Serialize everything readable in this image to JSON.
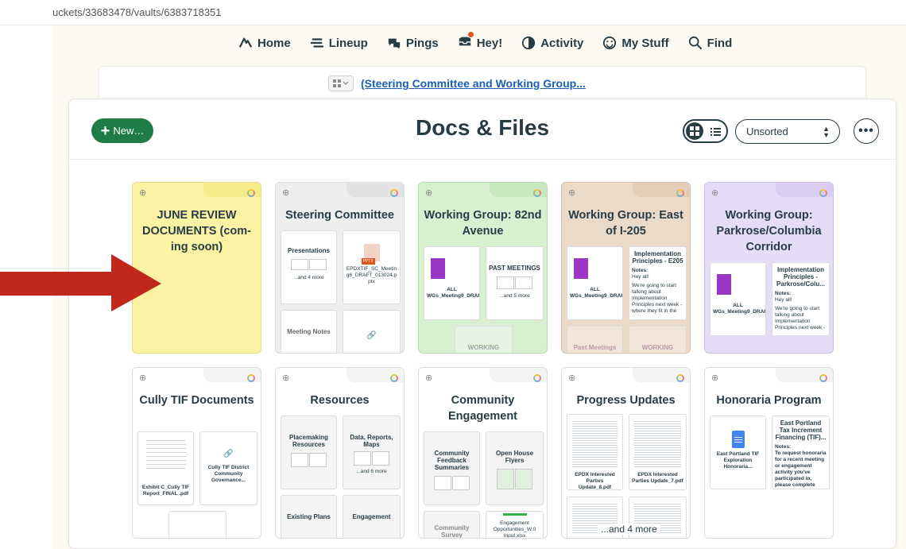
{
  "browser": {
    "url": "uckets/33683478/vaults/6383718351"
  },
  "nav": {
    "home": "Home",
    "lineup": "Lineup",
    "pings": "Pings",
    "hey": "Hey!",
    "activity": "Activity",
    "mystuff": "My Stuff",
    "find": "Find"
  },
  "breadcrumb": {
    "link": "(Steering Committee and Working Group..."
  },
  "page": {
    "title": "Docs & Files",
    "new_label": "New…",
    "sort_value": "Unsorted"
  },
  "colors": {
    "new_button": "#1e7c46",
    "link": "#1a5fb4",
    "arrow": "#c0281c"
  },
  "folders": [
    {
      "title": "JUNE REVIEW DOCUMENTS (com-ing soon)",
      "color": "#fbf3a3"
    },
    {
      "title": "Steering Committee",
      "color": "#eeeeee",
      "items": [
        "Presentations",
        "EPDXTIF_SC_Meeting6_DRAFT_013024.pptx",
        "Meeting Notes"
      ],
      "more": "...and 4 more",
      "badge": "PPTX"
    },
    {
      "title": "Working Group: 82nd Avenue",
      "color": "#d7f1d0",
      "items": [
        "ALL WGs_Meeting9_DRAFT_050124.pdf",
        "PAST MEETINGS",
        "WORKING"
      ],
      "more": "...and 5 more"
    },
    {
      "title": "Working Group: East of I-205",
      "color": "#ecdac9",
      "items": [
        "ALL WGs_Meeting9_DRAFT_050124.pdf",
        "Implementation Principles - E205",
        "Notes:",
        "Hey all!",
        "We're going to start talking about Implementation Principles next week - where they fit in the",
        "Past Meetings",
        "WORKING"
      ]
    },
    {
      "title": "Working Group: Parkrose/Columbia Corridor",
      "color": "#e5dcf7",
      "items": [
        "ALL WGs_Meeting9_DRAFT_050124.pdf",
        "Implementation Principles - Parkrose/Colu...",
        "Notes:",
        "Hey all!",
        "We're going to start talking about Implementation Principles next week -"
      ]
    },
    {
      "title": "Cully TIF Documents",
      "color": "#ffffff",
      "items": [
        "Exhibit C_Cully TIF Report_FINAL .pdf",
        "Cully TIF District Community Governance..."
      ]
    },
    {
      "title": "Resources",
      "color": "#ffffff",
      "items": [
        "Placemaking Resources",
        "Data, Reports, Maps",
        "Existing Plans",
        "Engagement"
      ],
      "more": "...and 6 more"
    },
    {
      "title": "Community Engagement",
      "color": "#ffffff",
      "items": [
        "Community Feedback Summaries",
        "Open House Flyers",
        "Community Survey",
        "Engagement Opportunities_W.0 Input.xlsx"
      ]
    },
    {
      "title": "Progress Updates",
      "color": "#ffffff",
      "items": [
        "EPDX Interested Parties Update_8.pdf",
        "EPDX Interested Parties Update_7.pdf"
      ],
      "more": "...and 4 more"
    },
    {
      "title": "Honoraria Program",
      "color": "#ffffff",
      "items": [
        "East Portland TIF Exploration Honoraria...",
        "East Portland Tax Increment Financing (TIF)...",
        "Notes:",
        "To request honoraria for a recent meeting or engagement activity you've participated in, please complete"
      ]
    }
  ]
}
